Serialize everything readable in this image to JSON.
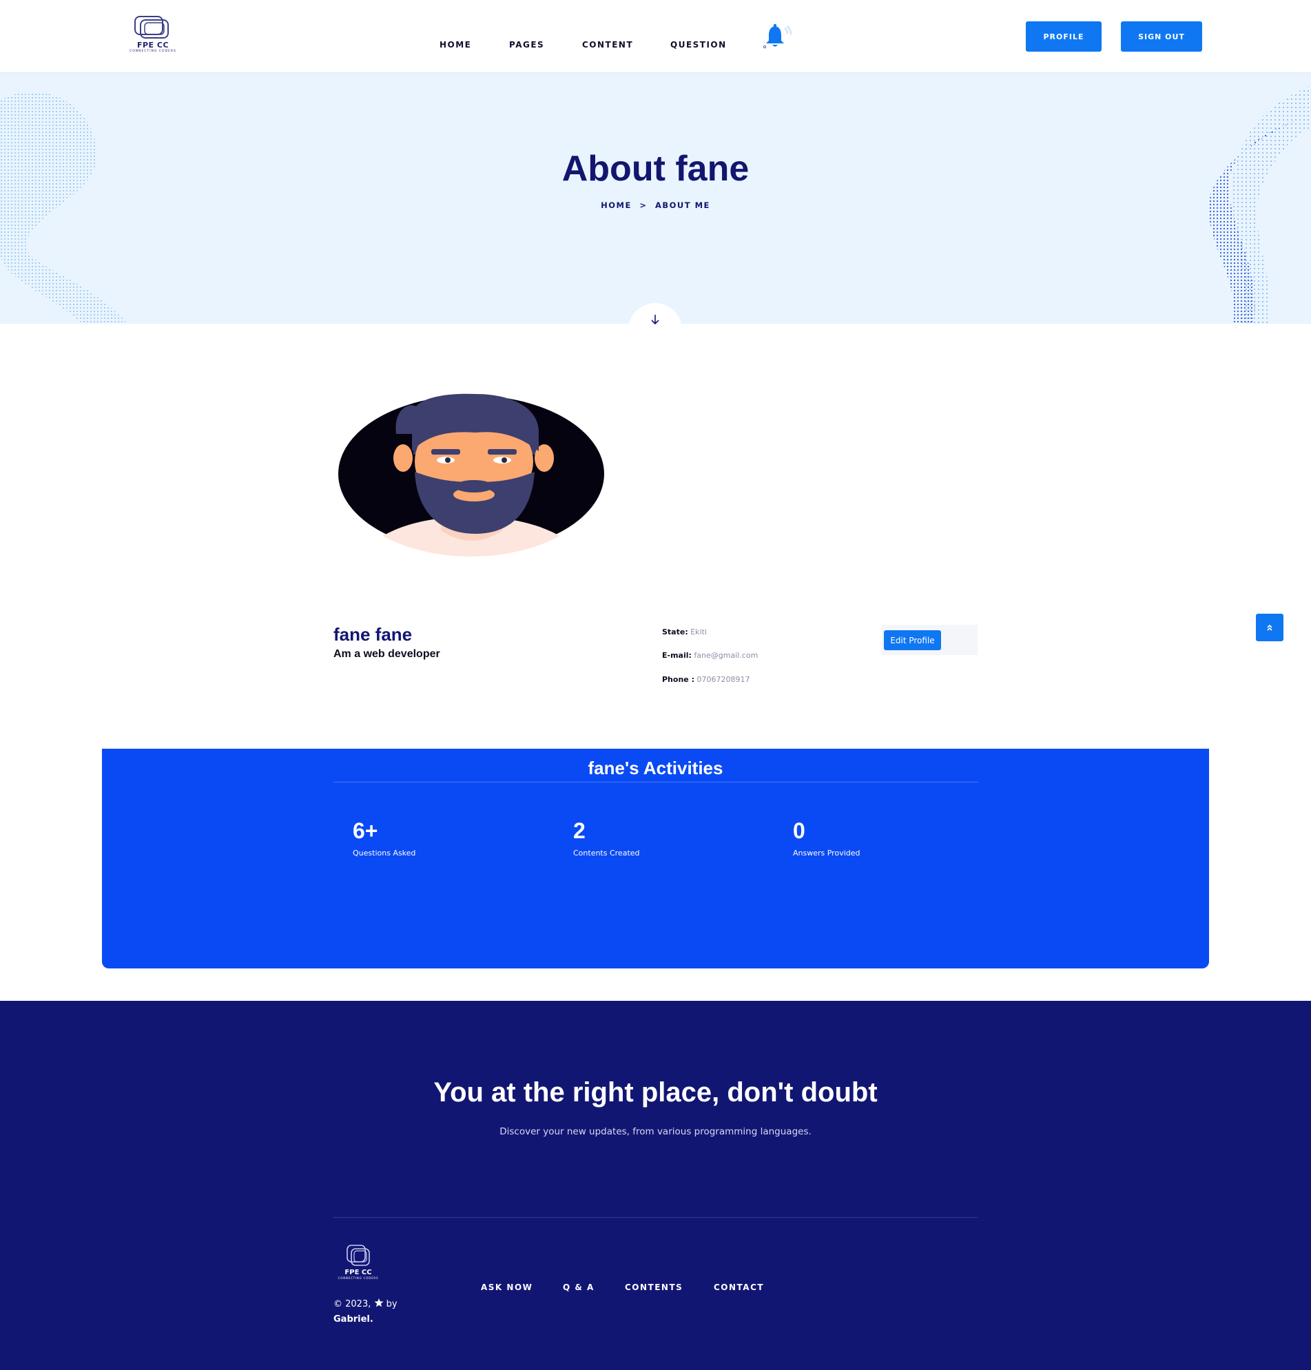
{
  "nav": {
    "logo_brand": "FPE CC",
    "logo_tagline": "CONNECTING CODERS",
    "menu": [
      "HOME",
      "PAGES",
      "CONTENT",
      "QUESTION"
    ],
    "profile_label": "PROFILE",
    "signout_label": "SIGN OUT",
    "accent_color": "#0f77f2",
    "icons": [
      "logo-icon",
      "bell-icon"
    ]
  },
  "hero": {
    "title": "About fane",
    "breadcrumb": [
      "HOME",
      ">",
      "ABOUT ME"
    ],
    "background": "#e9f4fe"
  },
  "profile": {
    "name": "fane fane",
    "bio": "Am a web developer",
    "state_label": "State:",
    "state_value": "Ekiti",
    "email_label": "E-mail:",
    "email_value": "fane@gmail.com",
    "phone_label": "Phone :",
    "phone_value": "07067208917",
    "edit_label": "Edit Profile"
  },
  "activities": {
    "title": "fane's Activities",
    "background": "#0a4af5",
    "stats": [
      {
        "value": "6+",
        "label": "Questions Asked"
      },
      {
        "value": "2",
        "label": "Contents Created"
      },
      {
        "value": "0",
        "label": "Answers Provided"
      }
    ]
  },
  "footer": {
    "heading": "You at the right place, don't doubt",
    "subtext": "Discover your new updates, from various programming languages.",
    "logo_brand": "FPE CC",
    "logo_tagline": "CONNECTING CODERS",
    "copyright_prefix": "© 2023,",
    "copyright_by": "by",
    "copyright_author": "Gabriel.",
    "menu": [
      "ASK NOW",
      "Q & A",
      "CONTENTS",
      "CONTACT"
    ],
    "background": "#121673"
  }
}
